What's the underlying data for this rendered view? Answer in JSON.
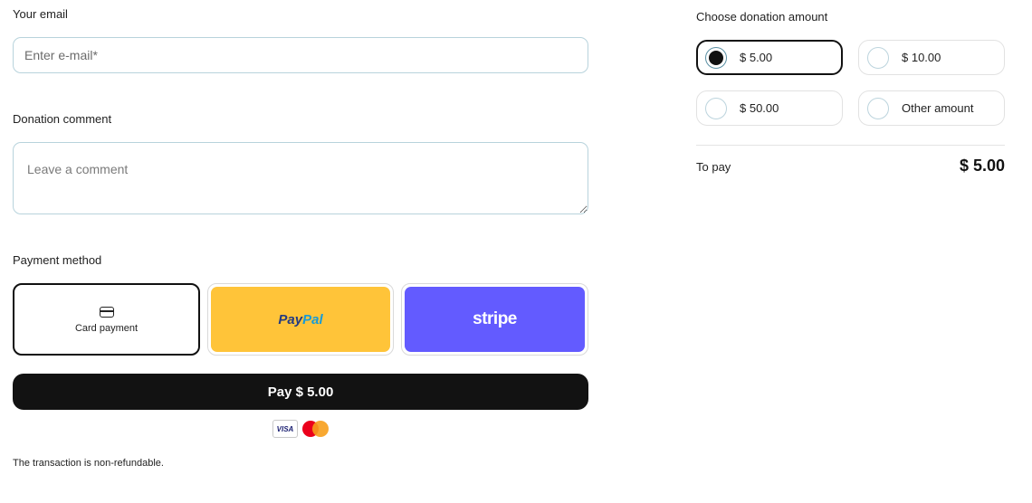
{
  "form": {
    "email_label": "Your email",
    "email_placeholder": "Enter e-mail*",
    "comment_label": "Donation comment",
    "comment_placeholder": "Leave a comment",
    "payment_label": "Payment method",
    "payment_methods": [
      {
        "name": "card",
        "label": "Card payment",
        "selected": true
      },
      {
        "name": "paypal",
        "label_part1": "Pay",
        "label_part2": "Pal",
        "color": "#ffc439"
      },
      {
        "name": "stripe",
        "label": "stripe",
        "color": "#635bff"
      }
    ],
    "pay_button_label": "Pay $ 5.00",
    "card_brands": {
      "visa": "VISA",
      "mastercard": "mastercard-icon"
    },
    "note": "The transaction is non-refundable."
  },
  "donation": {
    "title": "Choose donation amount",
    "options": [
      {
        "label": "$ 5.00",
        "selected": true
      },
      {
        "label": "$ 10.00",
        "selected": false
      },
      {
        "label": "$ 50.00",
        "selected": false
      },
      {
        "label": "Other amount",
        "selected": false
      }
    ],
    "to_pay_label": "To pay",
    "to_pay_value": "$ 5.00"
  }
}
